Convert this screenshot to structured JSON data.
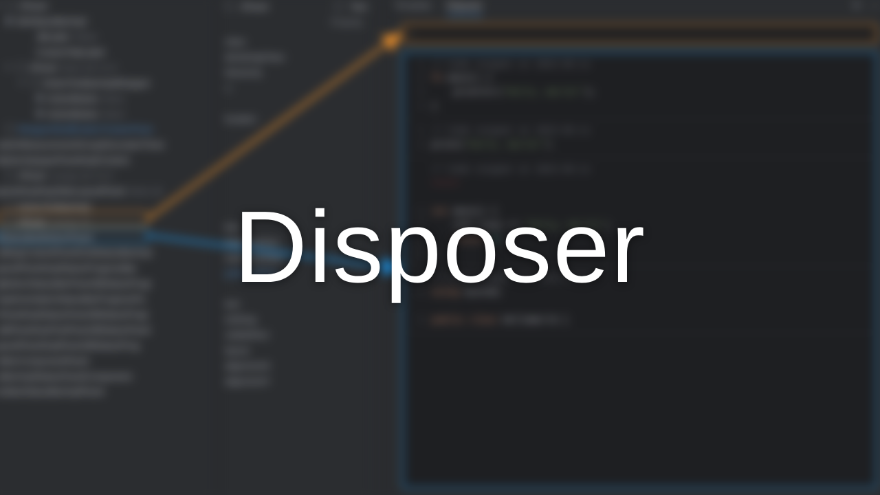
{
  "title_overlay": "Disposer",
  "tree": {
    "rows": [
      {
        "indent": 0,
        "chev": "▾",
        "box": true,
        "lbl": "JPanel",
        "dim": ""
      },
      {
        "indent": 1,
        "dot": true,
        "lbl": "IdeStatusBarImpl",
        "dim": ""
      },
      {
        "indent": 3,
        "lbl": "JBLabel",
        "dim": "#false"
      },
      {
        "indent": 3,
        "lbl": "CustomTabLabel",
        "dim": ""
      },
      {
        "indent": 1,
        "chev": "▾",
        "box": true,
        "lbl": "JPanel",
        "dim": "black @ 0,0,0"
      },
      {
        "indent": 2,
        "chev": "▾",
        "box": true,
        "lbl": "ActionToolbarImplWrapper",
        "dim": ""
      },
      {
        "indent": 3,
        "dot": true,
        "lbl": "ActionButton",
        "dim": "black"
      },
      {
        "indent": 3,
        "dot": true,
        "lbl": "ActionButton",
        "dim": "black"
      },
      {
        "indent": 1,
        "box": true,
        "link": true,
        "lbl": "WrapperModificationTrackerPane"
      },
      {
        "indent": 0,
        "lbl": "switchMeasurementGroupDecoratorTimer",
        "dim": ""
      },
      {
        "indent": 0,
        "lbl": "MyNonOpaquePanelImplContent",
        "dim": ""
      },
      {
        "indent": 1,
        "box": true,
        "lbl": "JPanel",
        "dim": "orange @ 0,0,0"
      },
      {
        "indent": 0,
        "lbl": "jpanelAnythingTabsLayoutPanel",
        "dim": "black @"
      },
      {
        "indent": 1,
        "box": true,
        "hl": "orange",
        "lbl": "ActionToolbarImpl",
        "dim": ""
      },
      {
        "indent": 1,
        "box": true,
        "hl": "blue",
        "lbl": "JPanel",
        "dim": "orange @"
      },
      {
        "indent": 0,
        "lbl": "gStatusBarBottomPanel",
        "dim": ""
      },
      {
        "indent": 0,
        "lbl": "editingContentPanelGridStatusBarImpl",
        "dim": ""
      },
      {
        "indent": 0,
        "lbl": "jpanelPanelImplStatusProgressBar",
        "dim": ""
      },
      {
        "indent": 0,
        "lbl": "gBottomStatusBarPanelJBStatusProgr",
        "dim": ""
      },
      {
        "indent": 0,
        "lbl": "implementationStatusBarProgressPa",
        "dim": ""
      },
      {
        "indent": 0,
        "lbl": "sPanelImplStatusPanelJBStatusProgr",
        "dim": ""
      },
      {
        "indent": 0,
        "lbl": "editPanelImplToolPanelJBStatusPanel",
        "dim": ""
      },
      {
        "indent": 0,
        "lbl": "jpanelPanelImplPanelJBStatusProg",
        "dim": ""
      },
      {
        "indent": 0,
        "lbl": "editorComponentPanel",
        "dim": ""
      },
      {
        "indent": 0,
        "lbl": "editorImplStatusPanelComponent",
        "dim": ""
      },
      {
        "indent": 0,
        "lbl": "toolbarStatusBarImplPanel",
        "dim": ""
      }
    ]
  },
  "props_header": {
    "a": "JPanel",
    "b": "Text"
  },
  "props_sub": "Property",
  "props": [
    {
      "t": "class"
    },
    {
      "t": "declaringClass"
    },
    {
      "t": "hierarchy"
    },
    {
      "t": "id",
      "faint": true
    },
    {
      "t": "",
      "faint": true
    },
    {
      "t": "location"
    },
    {
      "t": "",
      "faint": true
    },
    {
      "t": "",
      "faint": true
    },
    {
      "t": "",
      "faint": true
    },
    {
      "t": "",
      "faint": true
    },
    {
      "t": "",
      "faint": true
    },
    {
      "t": "",
      "faint": true
    },
    {
      "t": "text"
    },
    {
      "t": "minimumSize"
    },
    {
      "t": "maximumSize"
    },
    {
      "t": "preferredSize",
      "hl": true
    },
    {
      "t": ""
    },
    {
      "t": "text"
    },
    {
      "t": "toString"
    },
    {
      "t": "visibleRect"
    },
    {
      "t": "layout"
    },
    {
      "t": "alignmentX"
    },
    {
      "t": "alignmentY"
    },
    {
      "t": "",
      "faint": true
    },
    {
      "t": "",
      "faint": true
    }
  ],
  "tool": {
    "tabs": [
      "Template",
      "Disposer"
    ],
    "active_tab": 1,
    "ctrl_gear": "⚙",
    "ctrl_min": "—",
    "search_prefix": "⌕",
    "search_text": ""
  },
  "snippets": [
    {
      "lines": [
        {
          "n": "1",
          "seg": [
            {
              "c": "c-cmt",
              "t": "// Code snippet at 2023-09-1x"
            }
          ]
        },
        {
          "n": "2",
          "seg": [
            {
              "c": "c-kw",
              "t": "fn "
            },
            {
              "c": "c-fn",
              "t": "main"
            },
            {
              "t": "() {"
            }
          ]
        },
        {
          "n": "3",
          "seg": [
            {
              "t": "    "
            },
            {
              "c": "c-fn",
              "t": "println!"
            },
            {
              "t": "("
            },
            {
              "c": "c-str",
              "t": "\"Hello, World!\""
            },
            {
              "t": ");"
            }
          ]
        },
        {
          "n": "4",
          "seg": [
            {
              "t": "}"
            }
          ]
        }
      ]
    },
    {
      "lines": [
        {
          "n": "1",
          "seg": [
            {
              "c": "c-cmt",
              "t": "// Code snippet at 2023-09-1x"
            }
          ]
        },
        {
          "n": "2",
          "seg": [
            {
              "c": "c-fn",
              "t": "print"
            },
            {
              "t": "("
            },
            {
              "c": "c-str",
              "t": "\"Hello, World!\""
            },
            {
              "t": ")"
            }
          ]
        }
      ]
    },
    {
      "lines": [
        {
          "n": "",
          "seg": [
            {
              "c": "c-cmt",
              "t": "// Code snippet at 2023-09-1x"
            }
          ]
        },
        {
          "n": "",
          "seg": [
            {
              "c": "c-err",
              "t": "~~~~~"
            }
          ]
        },
        {
          "n": "",
          "seg": [
            {
              "t": ""
            }
          ]
        },
        {
          "n": "1",
          "seg": [
            {
              "c": "c-kw",
              "t": "int "
            },
            {
              "c": "c-fn",
              "t": "main"
            },
            {
              "t": "() {"
            }
          ]
        },
        {
          "n": "2",
          "seg": [
            {
              "t": "    std::cout << "
            },
            {
              "c": "c-str",
              "t": "\"Hello, World!\""
            },
            {
              "t": ";"
            }
          ]
        },
        {
          "n": "3",
          "seg": [
            {
              "t": "    "
            },
            {
              "c": "c-kw",
              "t": "return "
            },
            {
              "c": "c-num",
              "t": "0"
            },
            {
              "t": ";"
            }
          ]
        },
        {
          "n": "4",
          "seg": [
            {
              "t": "}"
            }
          ]
        }
      ]
    },
    {
      "lines": [
        {
          "n": "1",
          "seg": [
            {
              "c": "c-cmt",
              "t": "// Code snippet at 2023-09-1x"
            }
          ]
        },
        {
          "n": "2",
          "seg": [
            {
              "c": "c-kw",
              "t": "using "
            },
            {
              "t": "System;"
            }
          ]
        },
        {
          "n": "",
          "seg": [
            {
              "t": ""
            }
          ]
        },
        {
          "n": "3",
          "seg": [
            {
              "c": "c-kw",
              "t": "public class "
            },
            {
              "c": "c-fn",
              "t": "HelloWorld"
            },
            {
              "t": " {"
            }
          ]
        }
      ]
    }
  ]
}
